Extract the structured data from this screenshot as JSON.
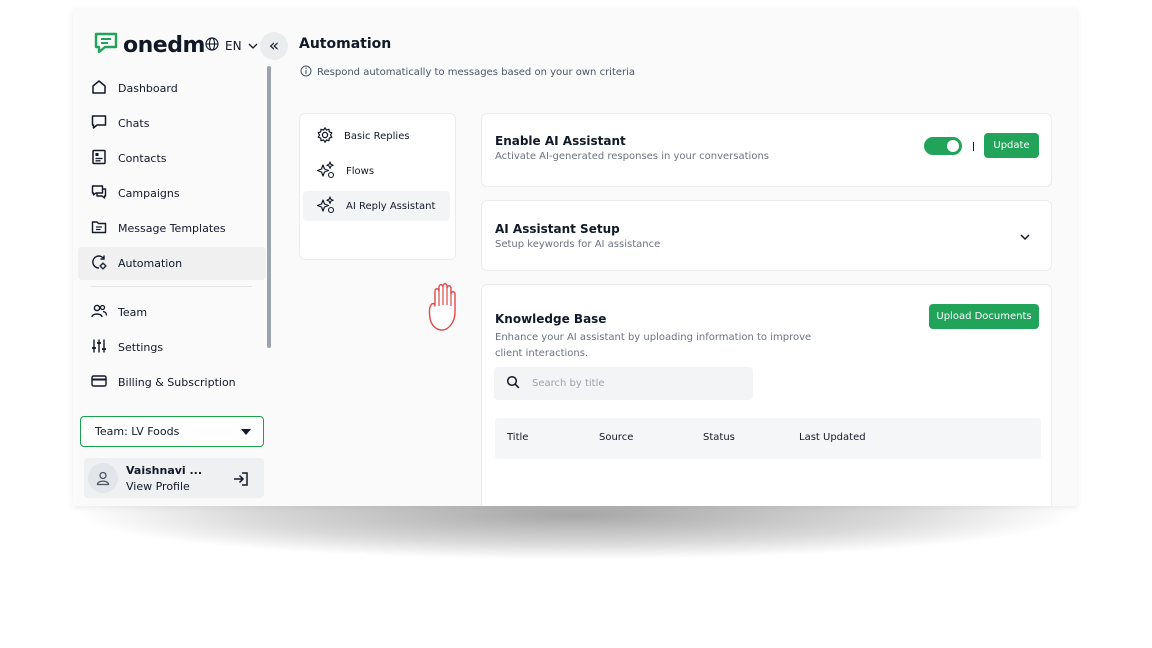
{
  "brand": {
    "name": "onedm",
    "accent": "#22a35a"
  },
  "language": {
    "code": "EN"
  },
  "sidebar": {
    "items": [
      {
        "label": "Dashboard",
        "icon": "home-icon"
      },
      {
        "label": "Chats",
        "icon": "chat-icon"
      },
      {
        "label": "Contacts",
        "icon": "contacts-icon"
      },
      {
        "label": "Campaigns",
        "icon": "campaigns-icon"
      },
      {
        "label": "Message Templates",
        "icon": "templates-icon"
      },
      {
        "label": "Automation",
        "icon": "automation-icon",
        "active": true
      },
      {
        "label": "Team",
        "icon": "team-icon"
      },
      {
        "label": "Settings",
        "icon": "sliders-icon"
      },
      {
        "label": "Billing & Subscription",
        "icon": "credit-card-icon"
      }
    ],
    "team_select": "Team: LV Foods",
    "profile": {
      "name": "Vaishnavi ...",
      "link": "View Profile"
    }
  },
  "header": {
    "title": "Automation",
    "subtitle": "Respond automatically to messages based on your own criteria"
  },
  "automation_menu": [
    {
      "label": "Basic Replies",
      "icon": "gear-icon"
    },
    {
      "label": "Flows",
      "icon": "sparkle-icon"
    },
    {
      "label": "AI Reply Assistant",
      "icon": "sparkle-icon",
      "active": true
    }
  ],
  "enable_card": {
    "title": "Enable AI Assistant",
    "desc": "Activate AI-generated responses in your conversations",
    "toggle_on": true,
    "update_label": "Update"
  },
  "setup_card": {
    "title": "AI Assistant Setup",
    "desc": "Setup keywords for AI assistance"
  },
  "kb_card": {
    "title": "Knowledge Base",
    "desc_line1": "Enhance your AI assistant by uploading information to improve",
    "desc_line2": "client interactions.",
    "upload_label": "Upload Documents",
    "search_placeholder": "Search by title",
    "columns": [
      "Title",
      "Source",
      "Status",
      "Last Updated"
    ]
  }
}
